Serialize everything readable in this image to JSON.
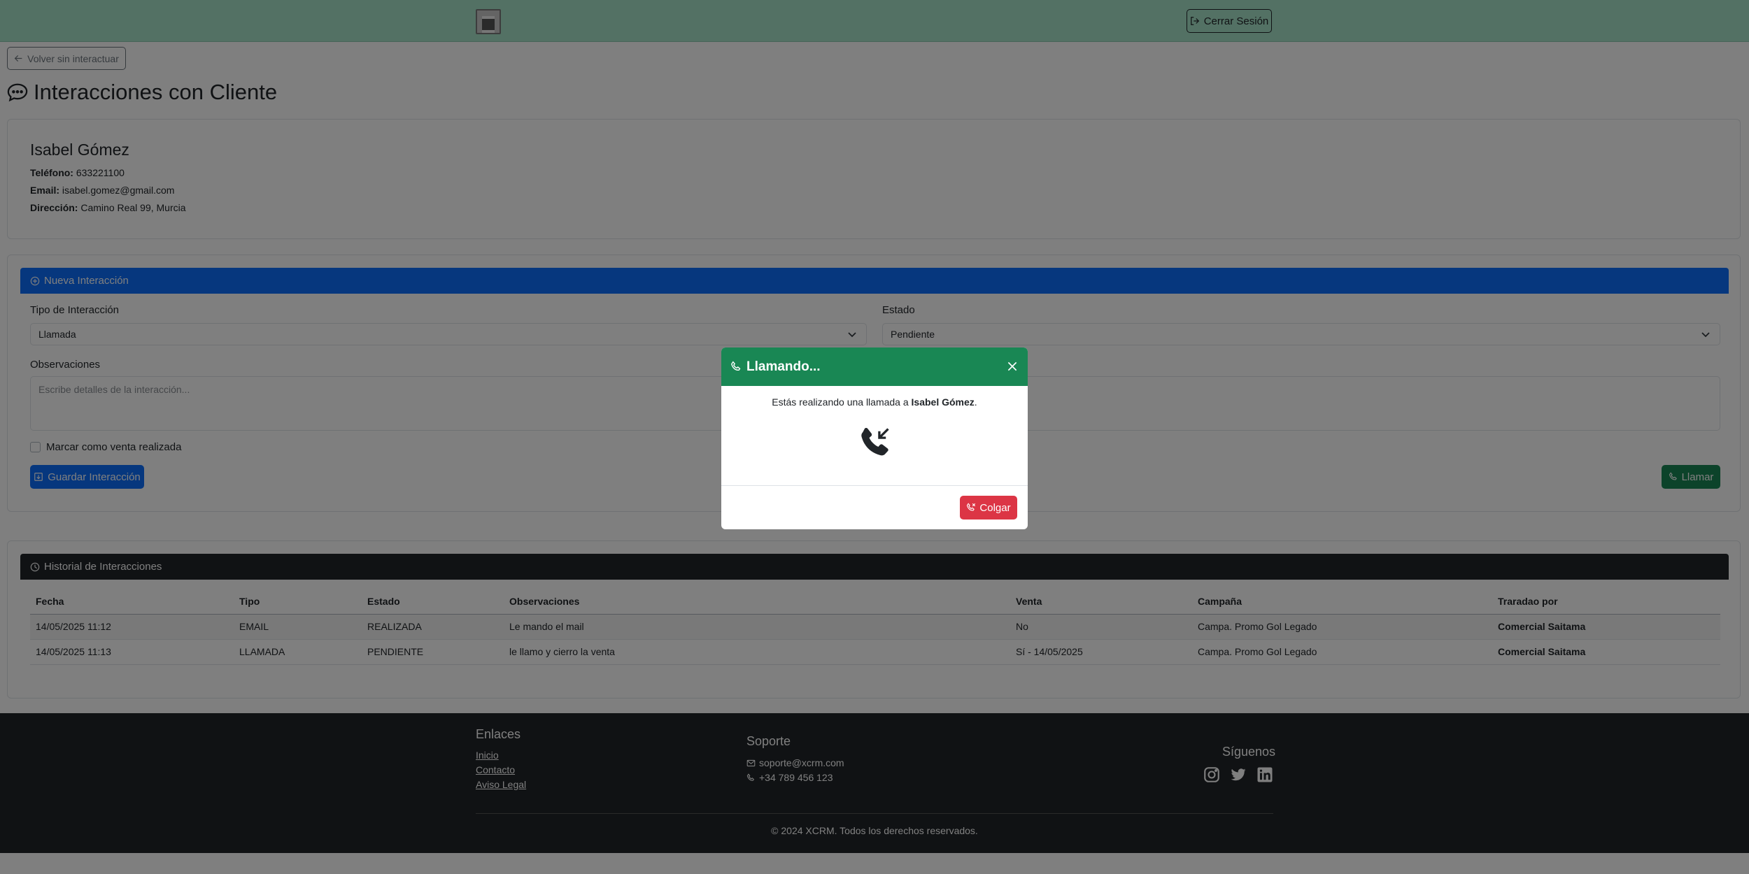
{
  "navbar": {
    "logout_label": "Cerrar Sesión"
  },
  "back_label": "Volver sin interactuar",
  "page_title": "Interacciones con Cliente",
  "client": {
    "name": "Isabel Gómez",
    "phone_label": "Teléfono:",
    "phone": "633221100",
    "email_label": "Email:",
    "email": "isabel.gomez@gmail.com",
    "address_label": "Dirección:",
    "address": "Camino Real 99, Murcia"
  },
  "new_interaction": {
    "header": "Nueva Interacción",
    "type_label": "Tipo de Interacción",
    "type_value": "Llamada",
    "status_label": "Estado",
    "status_value": "Pendiente",
    "notes_label": "Observaciones",
    "notes_placeholder": "Escribe detalles de la interacción...",
    "sale_checkbox_label": "Marcar como venta realizada",
    "save_label": "Guardar Interacción",
    "call_label": "Llamar"
  },
  "history": {
    "header": "Historial de Interacciones",
    "columns": [
      "Fecha",
      "Tipo",
      "Estado",
      "Observaciones",
      "Venta",
      "Campaña",
      "Traradao por"
    ],
    "rows": [
      [
        "14/05/2025 11:12",
        "EMAIL",
        "REALIZADA",
        "Le mando el mail",
        "No",
        "Campa. Promo Gol Legado",
        "Comercial Saitama"
      ],
      [
        "14/05/2025 11:13",
        "LLAMADA",
        "PENDIENTE",
        "le llamo y cierro la venta",
        "Sí - 14/05/2025",
        "Campa. Promo Gol Legado",
        "Comercial Saitama"
      ]
    ]
  },
  "footer": {
    "links_title": "Enlaces",
    "links": [
      "Inicio",
      "Contacto",
      "Aviso Legal"
    ],
    "support_title": "Soporte",
    "support_email": "soporte@xcrm.com",
    "support_phone": "+34 789 456 123",
    "social_title": "Síguenos",
    "copyright": "© 2024 XCRM. Todos los derechos reservados."
  },
  "modal": {
    "title": "Llamando...",
    "message_prefix": "Estás realizando una llamada a ",
    "message_name": "Isabel Gómez",
    "message_suffix": ".",
    "hangup_label": "Colgar"
  },
  "colors": {
    "navbar": "#a6e2c8",
    "primary": "#0d6efd",
    "success": "#198754",
    "danger": "#dc3545",
    "dark": "#212529"
  },
  "icons": [
    "logout-icon",
    "arrow-left-icon",
    "chat-icon",
    "plus-circle-icon",
    "chevron-down-icon",
    "save-icon",
    "phone-icon",
    "clock-icon",
    "envelope-icon",
    "instagram-icon",
    "twitter-icon",
    "linkedin-icon",
    "close-icon",
    "phone-incoming-icon"
  ]
}
